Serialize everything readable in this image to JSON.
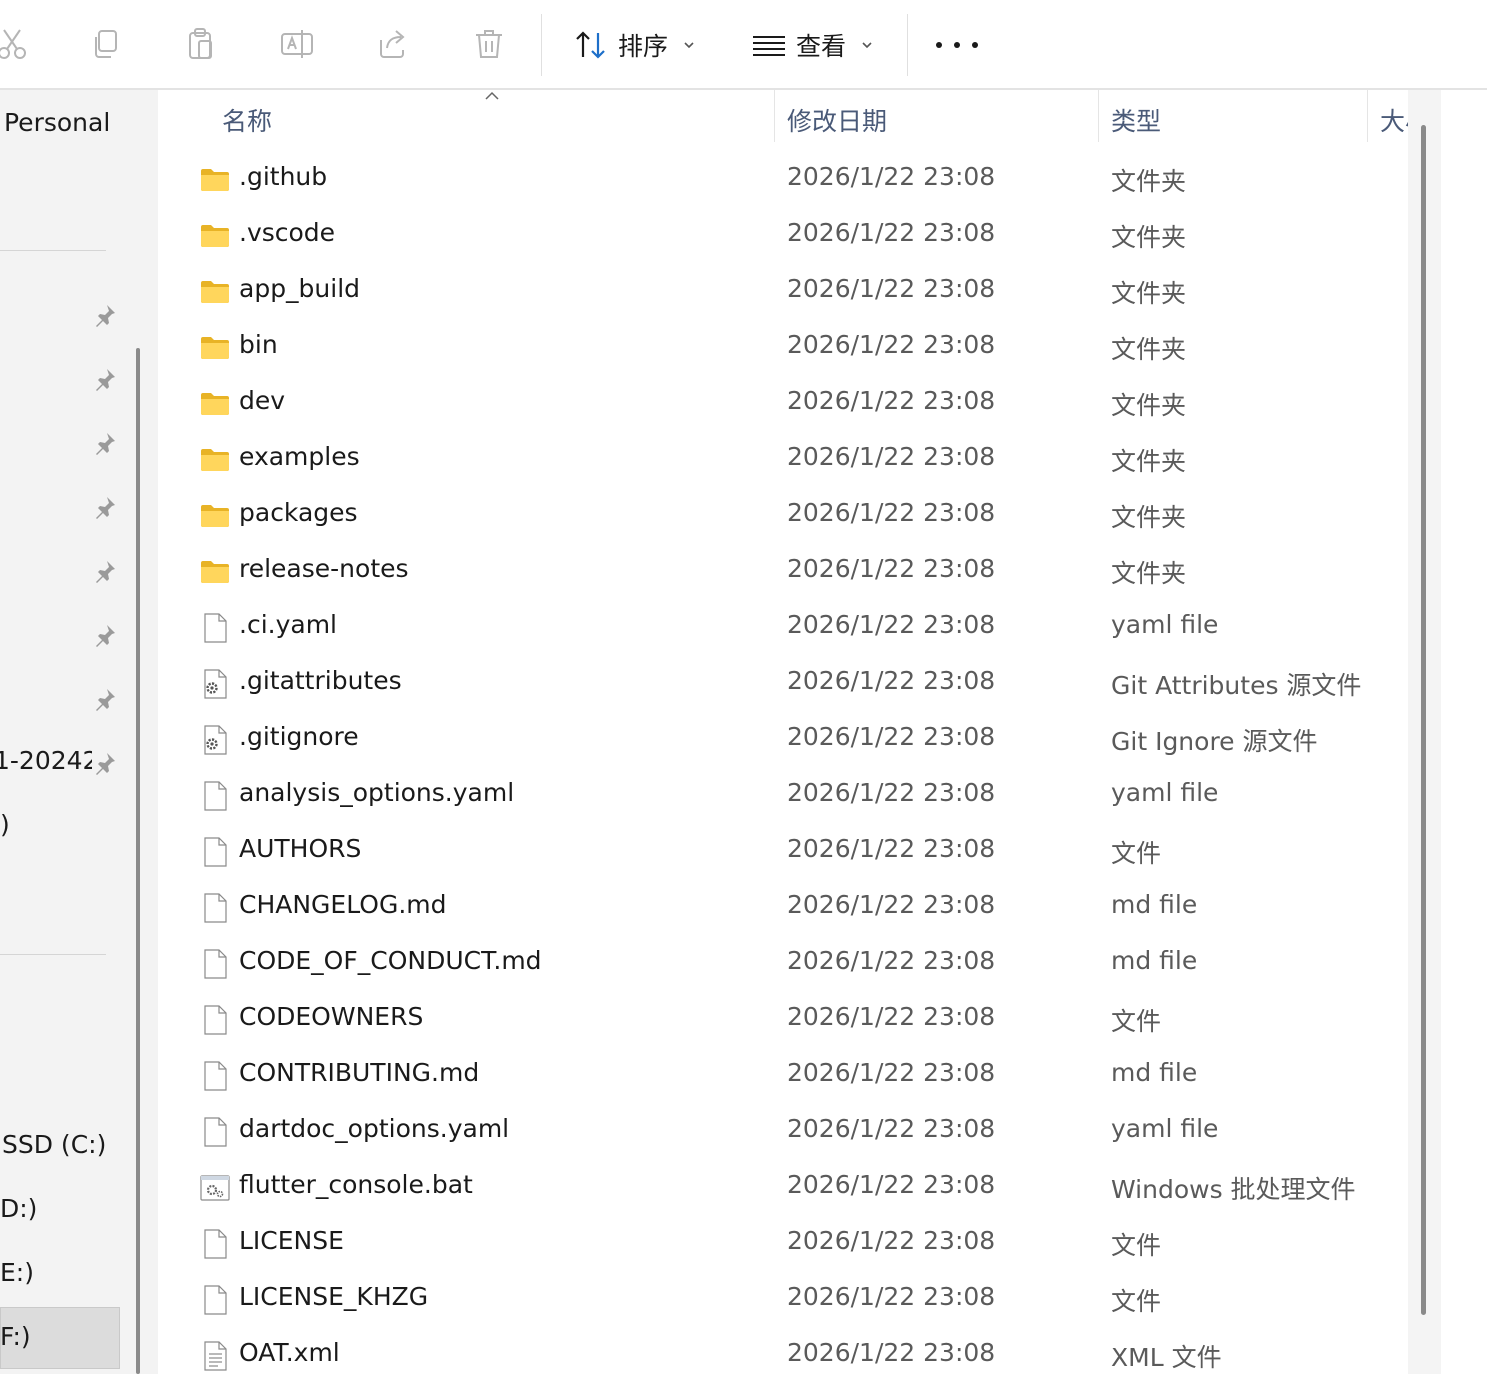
{
  "toolbar": {
    "sort_label": "排序",
    "view_label": "查看",
    "icons": [
      "cut-icon",
      "copy-icon",
      "paste-icon",
      "rename-icon",
      "share-icon",
      "delete-icon",
      "sort-icon",
      "view-icon",
      "more-icon"
    ]
  },
  "nav": {
    "personal": "Personal",
    "truncated_item_1": "1-20242",
    "truncated_item_2": ")",
    "drive_c": "SSD (C:)",
    "drive_d": "D:)",
    "drive_e": "E:)",
    "drive_f": "F:)",
    "selected": "F:)"
  },
  "columns": {
    "name": "名称",
    "date": "修改日期",
    "type": "类型",
    "size": "大小"
  },
  "files": [
    {
      "name": ".github",
      "date": "2026/1/22 23:08",
      "type": "文件夹",
      "icon": "folder-icon"
    },
    {
      "name": ".vscode",
      "date": "2026/1/22 23:08",
      "type": "文件夹",
      "icon": "folder-icon"
    },
    {
      "name": "app_build",
      "date": "2026/1/22 23:08",
      "type": "文件夹",
      "icon": "folder-icon"
    },
    {
      "name": "bin",
      "date": "2026/1/22 23:08",
      "type": "文件夹",
      "icon": "folder-icon"
    },
    {
      "name": "dev",
      "date": "2026/1/22 23:08",
      "type": "文件夹",
      "icon": "folder-icon"
    },
    {
      "name": "examples",
      "date": "2026/1/22 23:08",
      "type": "文件夹",
      "icon": "folder-icon"
    },
    {
      "name": "packages",
      "date": "2026/1/22 23:08",
      "type": "文件夹",
      "icon": "folder-icon"
    },
    {
      "name": "release-notes",
      "date": "2026/1/22 23:08",
      "type": "文件夹",
      "icon": "folder-icon"
    },
    {
      "name": ".ci.yaml",
      "date": "2026/1/22 23:08",
      "type": "yaml file",
      "icon": "file-icon"
    },
    {
      "name": ".gitattributes",
      "date": "2026/1/22 23:08",
      "type": "Git Attributes 源文件",
      "icon": "settings-file-icon"
    },
    {
      "name": ".gitignore",
      "date": "2026/1/22 23:08",
      "type": "Git Ignore 源文件",
      "icon": "settings-file-icon"
    },
    {
      "name": "analysis_options.yaml",
      "date": "2026/1/22 23:08",
      "type": "yaml file",
      "icon": "file-icon"
    },
    {
      "name": "AUTHORS",
      "date": "2026/1/22 23:08",
      "type": "文件",
      "icon": "file-icon"
    },
    {
      "name": "CHANGELOG.md",
      "date": "2026/1/22 23:08",
      "type": "md file",
      "icon": "file-icon"
    },
    {
      "name": "CODE_OF_CONDUCT.md",
      "date": "2026/1/22 23:08",
      "type": "md file",
      "icon": "file-icon"
    },
    {
      "name": "CODEOWNERS",
      "date": "2026/1/22 23:08",
      "type": "文件",
      "icon": "file-icon"
    },
    {
      "name": "CONTRIBUTING.md",
      "date": "2026/1/22 23:08",
      "type": "md file",
      "icon": "file-icon"
    },
    {
      "name": "dartdoc_options.yaml",
      "date": "2026/1/22 23:08",
      "type": "yaml file",
      "icon": "file-icon"
    },
    {
      "name": "flutter_console.bat",
      "date": "2026/1/22 23:08",
      "type": "Windows 批处理文件",
      "icon": "batch-file-icon"
    },
    {
      "name": "LICENSE",
      "date": "2026/1/22 23:08",
      "type": "文件",
      "icon": "file-icon"
    },
    {
      "name": "LICENSE_KHZG",
      "date": "2026/1/22 23:08",
      "type": "文件",
      "icon": "file-icon"
    },
    {
      "name": "OAT.xml",
      "date": "2026/1/22 23:08",
      "type": "XML 文件",
      "icon": "xml-file-icon"
    }
  ]
}
